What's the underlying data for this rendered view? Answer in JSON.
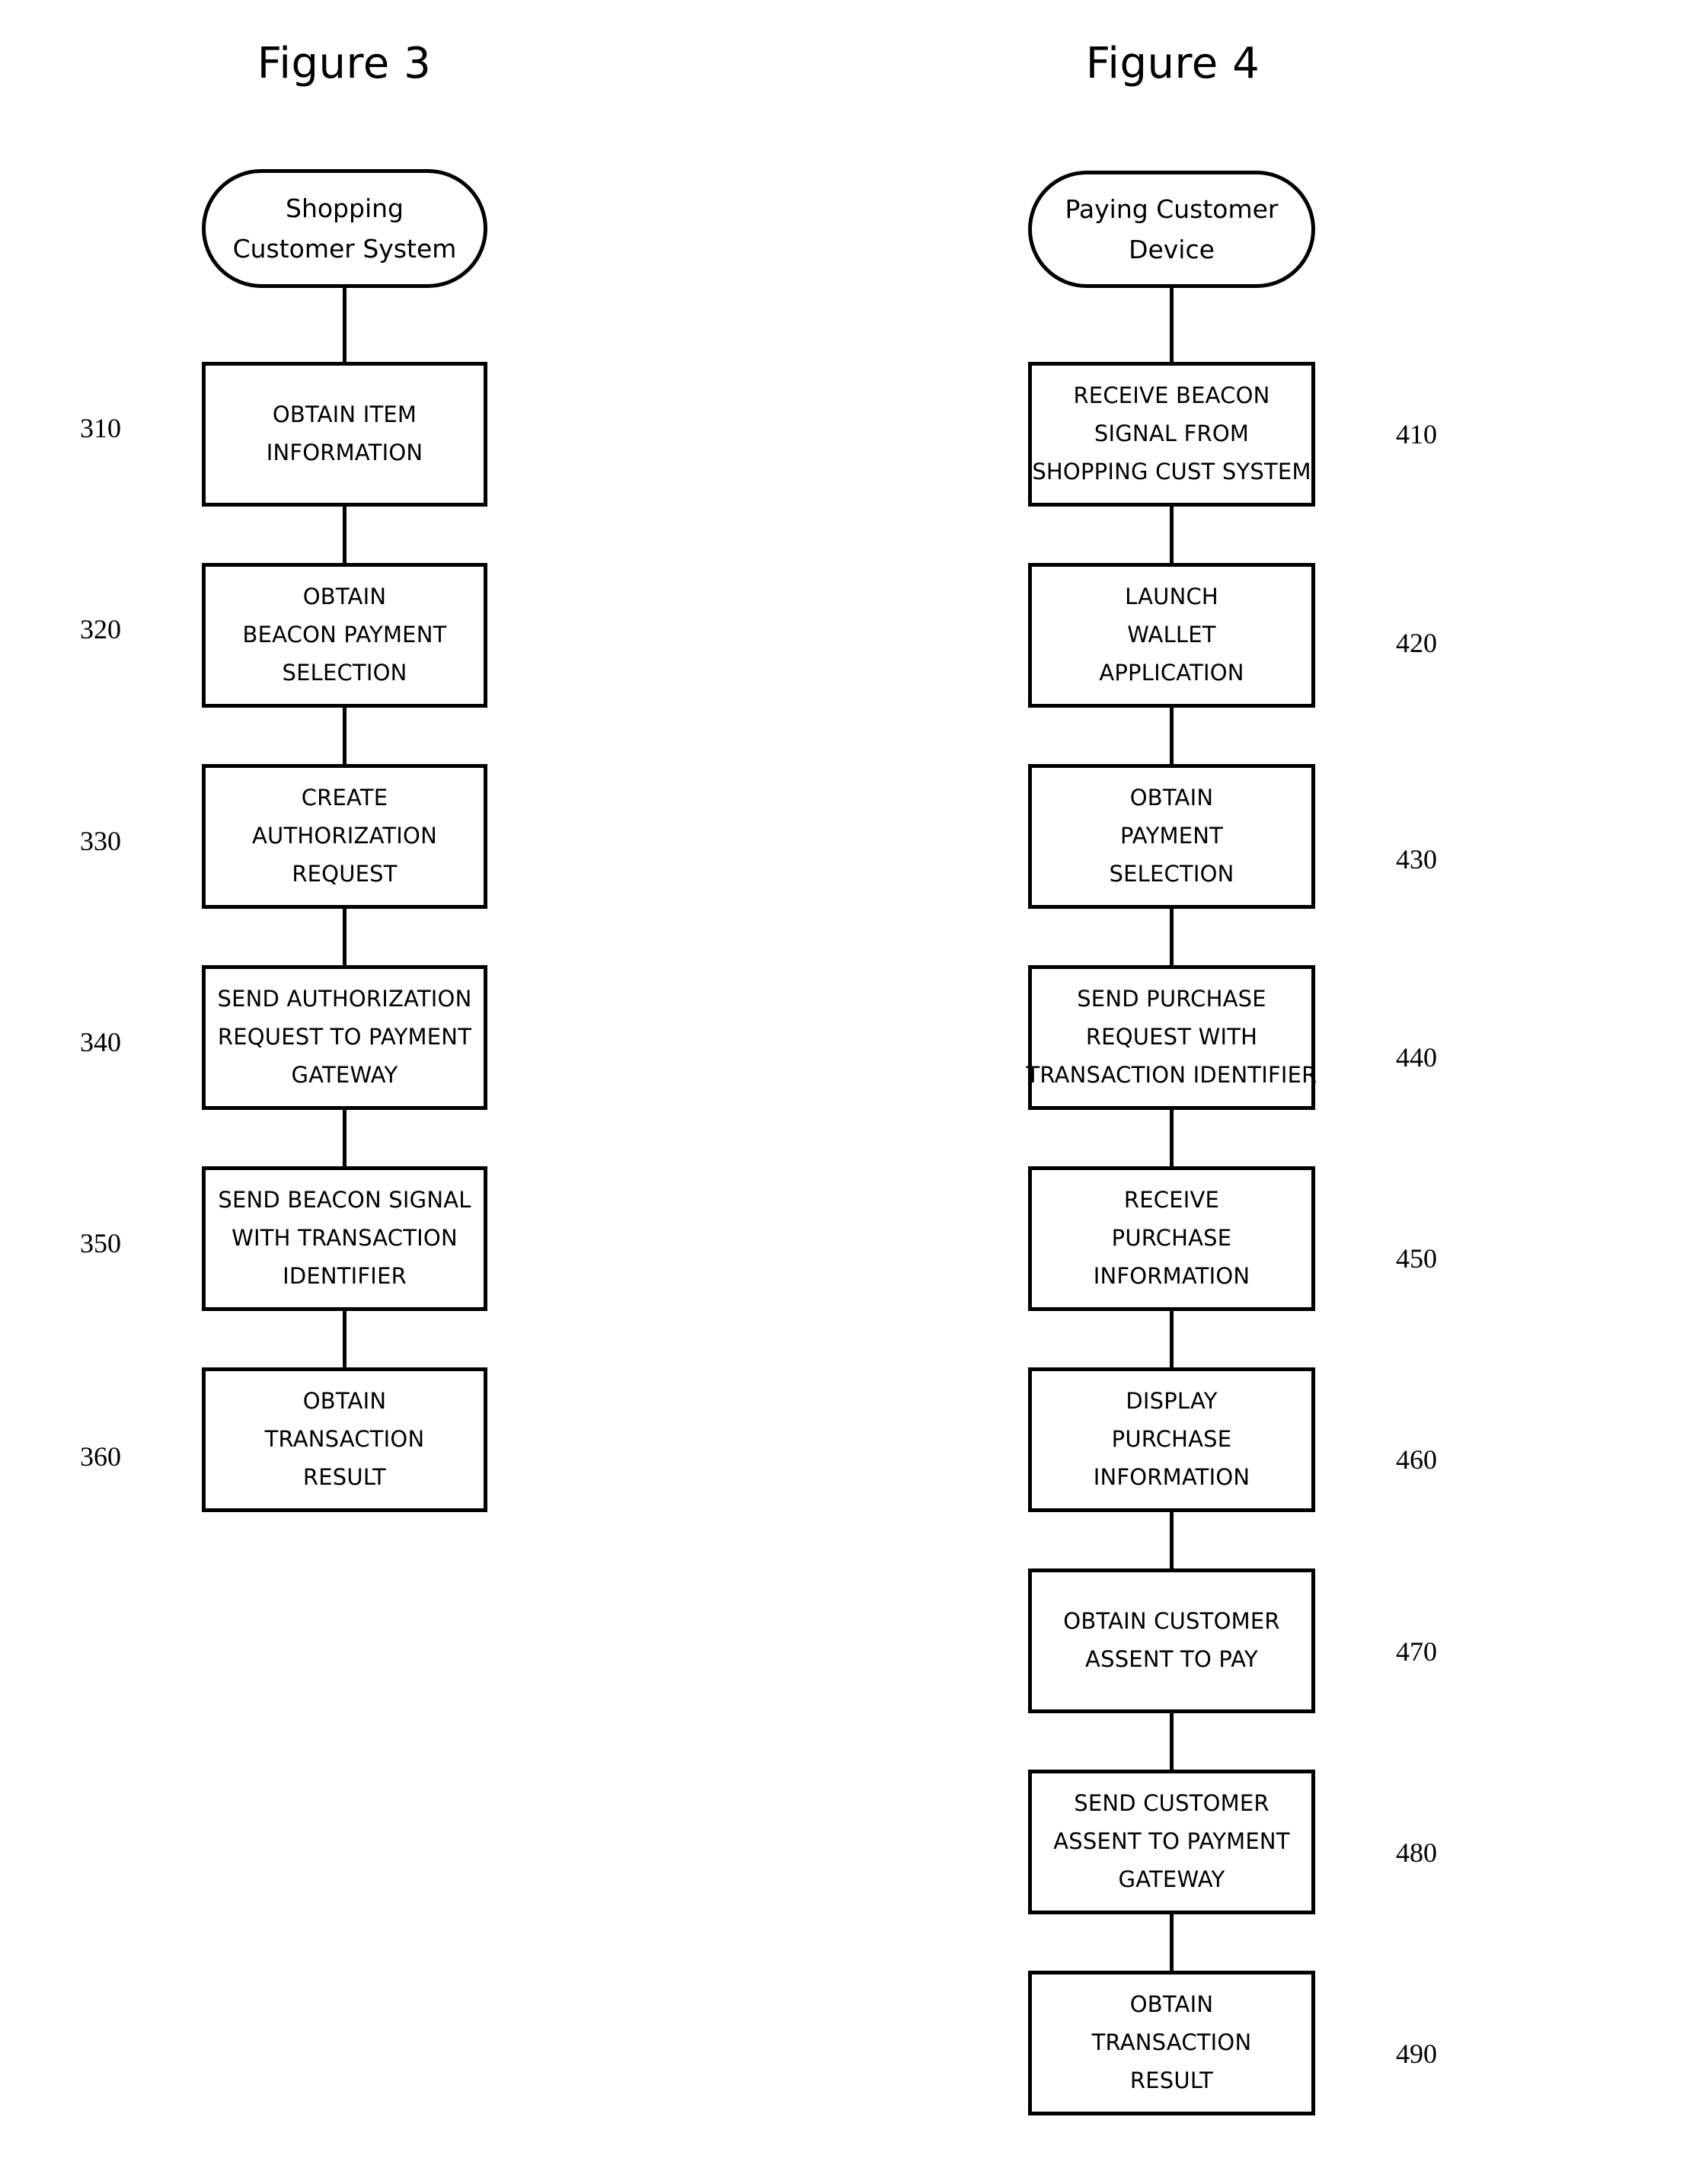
{
  "figures": [
    {
      "title": "Figure 3",
      "terminal": {
        "lines": [
          "Shopping",
          "Customer System"
        ]
      },
      "ref_side": "left",
      "steps": [
        {
          "ref": "310",
          "lines": [
            "OBTAIN ITEM",
            "INFORMATION"
          ]
        },
        {
          "ref": "320",
          "lines": [
            "OBTAIN",
            "BEACON PAYMENT",
            "SELECTION"
          ]
        },
        {
          "ref": "330",
          "lines": [
            "CREATE",
            "AUTHORIZATION",
            "REQUEST"
          ]
        },
        {
          "ref": "340",
          "lines": [
            "SEND AUTHORIZATION",
            "REQUEST TO PAYMENT",
            "GATEWAY"
          ]
        },
        {
          "ref": "350",
          "lines": [
            "SEND BEACON SIGNAL",
            "WITH TRANSACTION",
            "IDENTIFIER"
          ]
        },
        {
          "ref": "360",
          "lines": [
            "OBTAIN",
            "TRANSACTION",
            "RESULT"
          ]
        }
      ]
    },
    {
      "title": "Figure 4",
      "terminal": {
        "lines": [
          "Paying Customer",
          "Device"
        ]
      },
      "ref_side": "right",
      "steps": [
        {
          "ref": "410",
          "lines": [
            "RECEIVE BEACON",
            "SIGNAL FROM",
            "SHOPPING CUST SYSTEM"
          ]
        },
        {
          "ref": "420",
          "lines": [
            "LAUNCH",
            "WALLET",
            "APPLICATION"
          ]
        },
        {
          "ref": "430",
          "lines": [
            "OBTAIN",
            "PAYMENT",
            "SELECTION"
          ]
        },
        {
          "ref": "440",
          "lines": [
            "SEND PURCHASE",
            "REQUEST WITH",
            "TRANSACTION IDENTIFIER"
          ]
        },
        {
          "ref": "450",
          "lines": [
            "RECEIVE",
            "PURCHASE",
            "INFORMATION"
          ]
        },
        {
          "ref": "460",
          "lines": [
            "DISPLAY",
            "PURCHASE",
            "INFORMATION"
          ]
        },
        {
          "ref": "470",
          "lines": [
            "OBTAIN CUSTOMER",
            "ASSENT TO PAY"
          ]
        },
        {
          "ref": "480",
          "lines": [
            "SEND CUSTOMER",
            "ASSENT TO PAYMENT",
            "GATEWAY"
          ]
        },
        {
          "ref": "490",
          "lines": [
            "OBTAIN",
            "TRANSACTION",
            "RESULT"
          ]
        }
      ]
    }
  ],
  "colors": {
    "stroke": "#000000",
    "background": "#ffffff"
  }
}
